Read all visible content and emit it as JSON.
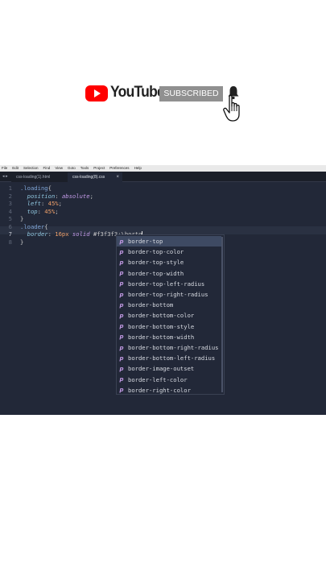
{
  "banner": {
    "youtube_text": "YouTube",
    "subscribed_label": "SUBSCRIBED",
    "colors": {
      "youtube_red": "#ff0000",
      "subscribed_bg": "#909090"
    }
  },
  "editor": {
    "menu": [
      "File",
      "Edit",
      "Selection",
      "Find",
      "View",
      "Goto",
      "Tools",
      "Project",
      "Preferences",
      "Help"
    ],
    "tabs": [
      {
        "label": "css-loading(1).html",
        "active": false
      },
      {
        "label": "css-loading(8).css",
        "active": true
      }
    ],
    "tab_nav": "◂ ▸",
    "tab_close": "×",
    "active_line": 7,
    "line_numbers": [
      "1",
      "2",
      "3",
      "4",
      "5",
      "6",
      "7",
      "8"
    ],
    "code": {
      "l1": {
        "sel": ".loading",
        "pun": "{"
      },
      "l2": {
        "prop": "position",
        "colon": ":",
        "val": "absolute",
        "semi": ";"
      },
      "l3": {
        "prop": "left",
        "colon": ":",
        "num": "45%",
        "semi": ";"
      },
      "l4": {
        "prop": "top",
        "colon": ":",
        "num": "45%",
        "semi": ";"
      },
      "l5": {
        "pun": "}"
      },
      "l6": {
        "sel": ".loader",
        "pun": "{"
      },
      "l7": {
        "prop": "border",
        "colon": ":",
        "num": "16px",
        "val": "solid",
        "hex": "#f3f3f3",
        "rest": ";\\borto"
      },
      "l8": {
        "pun": "}"
      }
    },
    "autocomplete": {
      "selected_index": 0,
      "icon": "p",
      "items": [
        "border-top",
        "border-top-color",
        "border-top-style",
        "border-top-width",
        "border-top-left-radius",
        "border-top-right-radius",
        "border-bottom",
        "border-bottom-color",
        "border-bottom-style",
        "border-bottom-width",
        "border-bottom-right-radius",
        "border-bottom-left-radius",
        "border-image-outset",
        "border-left-color",
        "border-right-color"
      ]
    },
    "colors": {
      "background": "#222838",
      "selector": "#7fa5d6",
      "property": "#8fc5dd",
      "value": "#c39be8",
      "number": "#f0a06a"
    }
  }
}
